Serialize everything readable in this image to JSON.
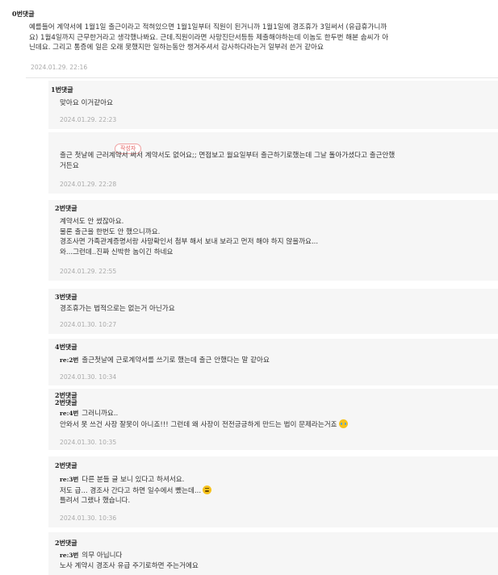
{
  "comments": {
    "c0": {
      "author": "0번댓글",
      "lines": [
        "예를들어 계약서에 1월1일 출근이라고 적혀있으면 1월1일부터 직원이 된거니까 1월1일에 경조휴가 3일써서 (유급휴가니까",
        "요) 1월4일까지 근무한거라고 생각했나봐요. 근데.직원이라면 사망진단서등등 제출해야하는데 이놈도 한두번 해본 솜씨가 아",
        "닌데요. 그리고 통증에 일은 오래 못했지만 일하는동안 챙겨주셔서 감사하다라는거 일부러 쓴거 같아요"
      ],
      "date": "2024.01.29. 22:16"
    },
    "c1": {
      "author": "1번댓글",
      "text": "맞아요 이거같아요",
      "date": "2024.01.29. 22:23"
    },
    "op": {
      "badge": "작성자",
      "lines": [
        "출근 첫날에 근러계약서 써서 계약서도 없어요;; 면접보고 월요일부터 출근하기로했는데 그날 돌아가셨다고 출근안했",
        "거든요"
      ],
      "date": "2024.01.29. 22:28"
    },
    "c2": {
      "author": "2번댓글",
      "lines": [
        "계약서도 안 썼잖아요.",
        "물론 출근을 한번도 안 했으니까요.",
        "경조사면 가족관계증명서랑 사망확인서 첨부 해서 보내 보라고 먼저 해야 하지 않을까요...",
        "와...그런데..진짜 신박한 놈이긴 하네요"
      ],
      "date": "2024.01.29. 22:55"
    },
    "c3": {
      "author": "3번댓글",
      "text": "경조휴가는 법적으로는 없는거 아닌가요",
      "date": "2024.01.30. 10:27"
    },
    "c4": {
      "author": "4번댓글",
      "re": "re:2번",
      "text": "출근첫날에 근로계약서를 쓰기로 했는데 출근 안했다는 말 같아요",
      "date": "2024.01.30. 10:34"
    },
    "c5": {
      "author_a": "2번댓글",
      "author_b": "2번댓글",
      "re": "re:4번",
      "line1": "그러니까요..",
      "line2": "안와서 못 쓰건 사장 잘못이 아니죠!!! 그런데 왜 사장이 전전긍긍하게 만드는 법이 문제라는거죠",
      "emoji": "crying-face-icon",
      "date": "2024.01.30. 10:35"
    },
    "c6": {
      "author": "2번댓글",
      "re": "re:3번",
      "line1": "다른 분들 글 보니 있다고 하셔서요.",
      "line2": "저도 급... 경조사 간다고 하면 일수에서 뺐는데...",
      "line3": "틀려서 그랬나 했습니다.",
      "emoji": "sweat-smile-icon",
      "date": "2024.01.30. 10:36"
    },
    "c7": {
      "author": "2번댓글",
      "re": "re:3번",
      "line1": "의무 아닙니다",
      "line2": "노사 계약시 경조사 유급 주기로하면 주는거에요"
    }
  }
}
